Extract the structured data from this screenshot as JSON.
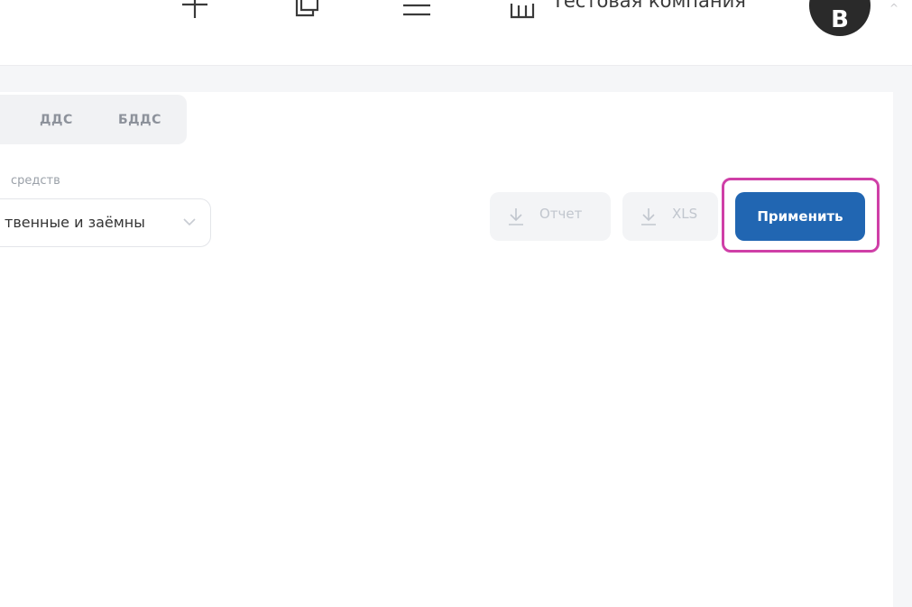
{
  "header": {
    "company_name": "Тестовая компания",
    "avatar_letter": "В",
    "edge_fragment": "^"
  },
  "tabs": [
    {
      "label": "ДДС"
    },
    {
      "label": "БДДС"
    }
  ],
  "filter": {
    "label": "средств",
    "value": "твенные и заёмны"
  },
  "actions": {
    "report_label": "Отчет",
    "xls_label": "XLS",
    "apply_label": "Применить"
  },
  "colors": {
    "accent": "#2166b2",
    "highlight": "#cf3fa7",
    "disabled": "#c1c6ce"
  }
}
